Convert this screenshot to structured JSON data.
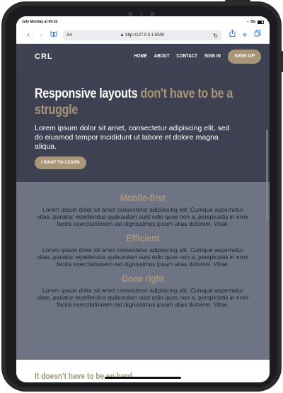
{
  "statusbar": {
    "time_date": "July Monday at 09:32",
    "network": "5G"
  },
  "browser": {
    "aa_label": "AA",
    "url": "http://127.0.0.1:5500"
  },
  "nav": {
    "logo": "CRL",
    "links": [
      "HOME",
      "ABOUT",
      "CONTACT",
      "SIGN IN"
    ],
    "signup_label": "SIGN UP"
  },
  "hero": {
    "title_main": "Responsive layouts ",
    "title_accent": "don't have to be a struggle",
    "text": "Lorem ipsum dolor sit amet, consectetur adipiscing elit, sed do eiusmod tempor incididunt ut labore et dolore magna aliqua.",
    "cta_label": "I WANT TO LEARN"
  },
  "features": [
    {
      "title": "Mobile-first",
      "text": "Lorem ipsum dolor sit amet consectetur adipisicing elit. Cumque aspernatur vitae, pariatur repellendus quibusdam sunt odio quos non a, perspiciatis in error facilis exercitationem est dignissimos ipsam alias dolorem. Vitae."
    },
    {
      "title": "Efficient",
      "text": "Lorem ipsum dolor sit amet consectetur adipisicing elit. Cumque aspernatur vitae, pariatur repellendus quibusdam sunt odio quos non a, perspiciatis in error facilis exercitationem est dignissimos ipsam alias dolorem. Vitae."
    },
    {
      "title": "Done right",
      "text": "Lorem ipsum dolor sit amet consectetur adipisicing elit. Cumque aspernatur vitae, pariatur repellendus quibusdam sunt odio quos non a, perspiciatis in error facilis exercitationem est dignissimos ipsam alias dolorem. Vitae."
    }
  ],
  "footer": {
    "heading": "It doesn't have to be so hard"
  },
  "colors": {
    "navy": "#3d4152",
    "slate": "#6f7485",
    "accent": "#a89677"
  },
  "icons": [
    "back-icon",
    "forward-icon",
    "bookmarks-icon",
    "lock-icon",
    "reload-icon",
    "share-icon",
    "new-tab-icon",
    "tabs-icon"
  ]
}
